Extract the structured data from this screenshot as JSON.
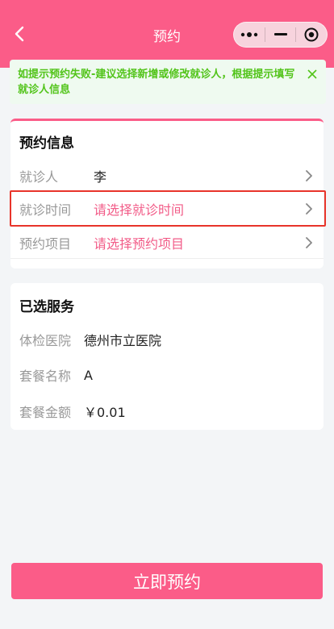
{
  "header": {
    "title": "预约",
    "back_icon": "chevron-left-icon",
    "capsule": {
      "more_icon": "more-dots-icon",
      "minimize_icon": "minimize-icon",
      "close_icon": "target-close-icon"
    }
  },
  "tip": {
    "text": "如提示预约失败-建议选择新增或修改就诊人，根据提示填写就诊人信息",
    "close_icon": "close-icon"
  },
  "booking": {
    "title": "预约信息",
    "rows": [
      {
        "label": "就诊人",
        "value": "李",
        "placeholder": false
      },
      {
        "label": "就诊时间",
        "value": "请选择就诊时间",
        "placeholder": true
      },
      {
        "label": "预约项目",
        "value": "请选择预约项目",
        "placeholder": true
      }
    ]
  },
  "service": {
    "title": "已选服务",
    "rows": [
      {
        "label": "体检医院",
        "value": "德州市立医院"
      },
      {
        "label": "套餐名称",
        "value": "A"
      },
      {
        "label": "套餐金额",
        "value": "￥0.01"
      }
    ]
  },
  "submit": {
    "label": "立即预约"
  },
  "colors": {
    "brand": "#fb5c88",
    "tip_text": "#52c41a",
    "highlight": "#e8342a"
  }
}
